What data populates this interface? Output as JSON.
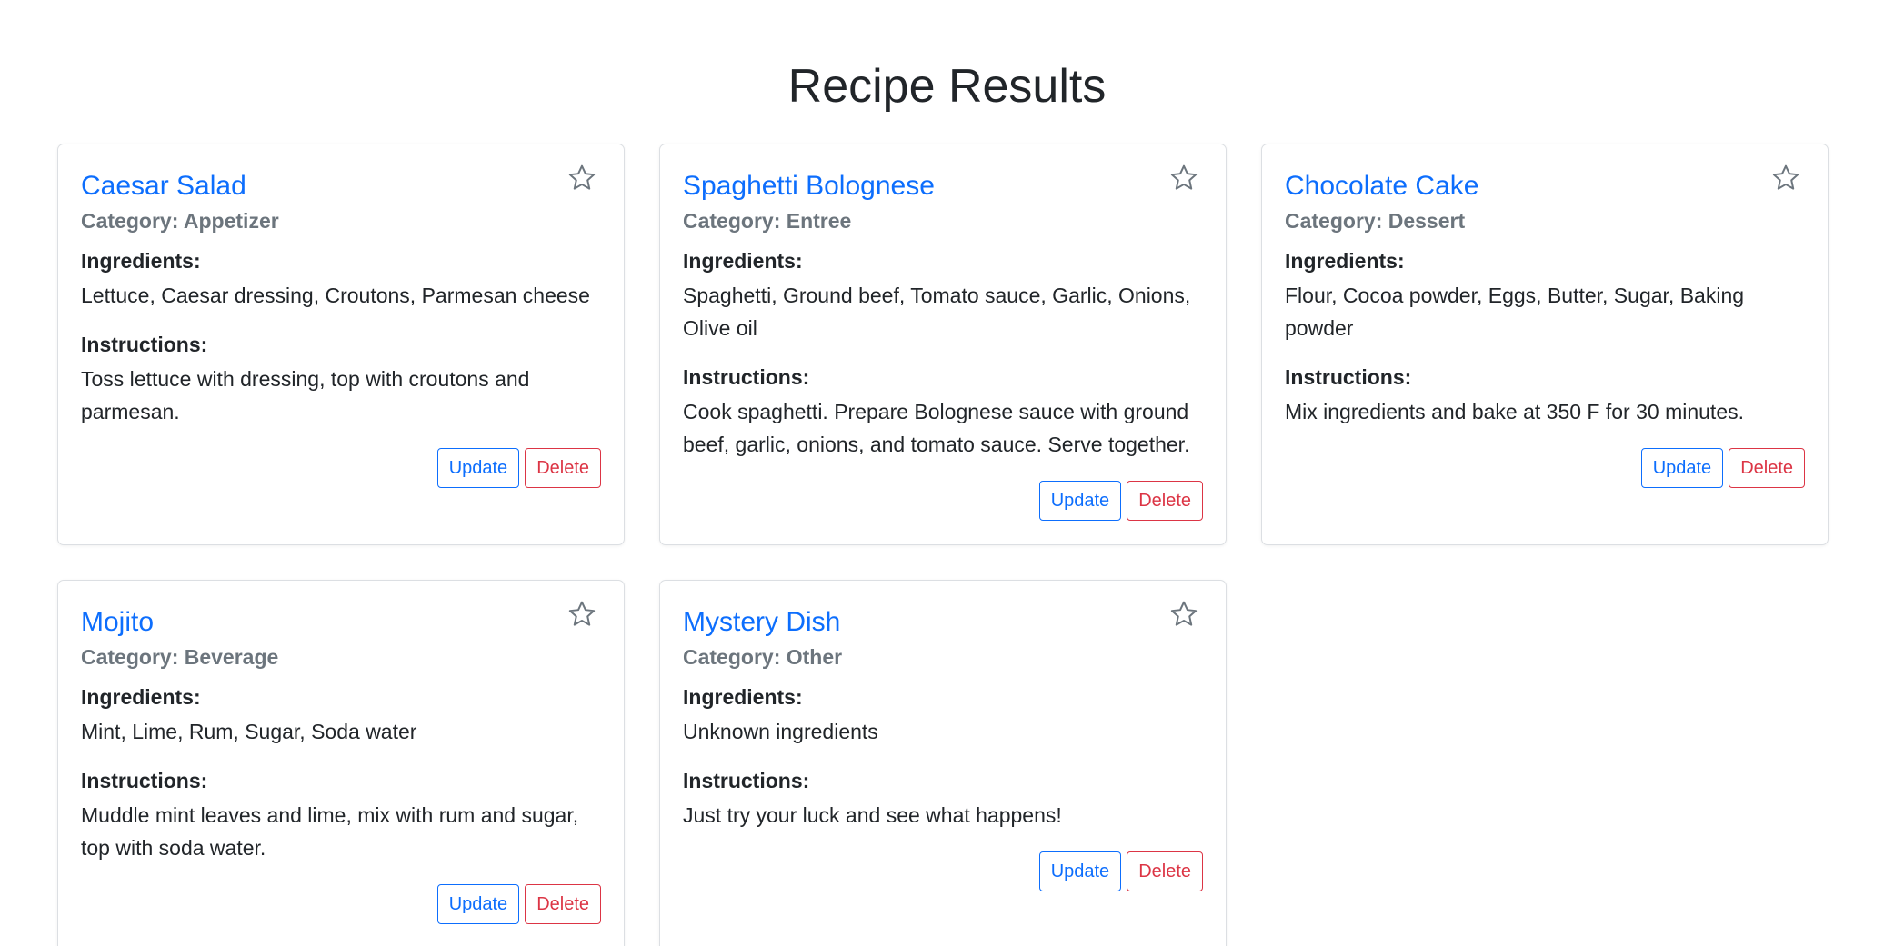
{
  "page": {
    "title": "Recipe Results"
  },
  "colors": {
    "accent": "#0d6efd",
    "danger": "#dc3545",
    "muted": "#6c757d",
    "text": "#212529",
    "star_outline": "#6c757d"
  },
  "labels": {
    "ingredients": "Ingredients:",
    "instructions": "Instructions:",
    "update": "Update",
    "delete": "Delete"
  },
  "recipes": [
    {
      "name": "Caesar Salad",
      "category": "Category: Appetizer",
      "ingredients": "Lettuce, Caesar dressing, Croutons, Parmesan cheese",
      "instructions": "Toss lettuce with dressing, top with croutons and parmesan.",
      "favorite_icon": "star-outline-icon"
    },
    {
      "name": "Spaghetti Bolognese",
      "category": "Category: Entree",
      "ingredients": "Spaghetti, Ground beef, Tomato sauce, Garlic, Onions, Olive oil",
      "instructions": "Cook spaghetti. Prepare Bolognese sauce with ground beef, garlic, onions, and tomato sauce. Serve together.",
      "favorite_icon": "star-outline-icon"
    },
    {
      "name": "Chocolate Cake",
      "category": "Category: Dessert",
      "ingredients": "Flour, Cocoa powder, Eggs, Butter, Sugar, Baking powder",
      "instructions": "Mix ingredients and bake at 350 F for 30 minutes.",
      "favorite_icon": "star-outline-icon"
    },
    {
      "name": "Mojito",
      "category": "Category: Beverage",
      "ingredients": "Mint, Lime, Rum, Sugar, Soda water",
      "instructions": "Muddle mint leaves and lime, mix with rum and sugar, top with soda water.",
      "favorite_icon": "star-outline-icon"
    },
    {
      "name": "Mystery Dish",
      "category": "Category: Other",
      "ingredients": "Unknown ingredients",
      "instructions": "Just try your luck and see what happens!",
      "favorite_icon": "star-outline-icon"
    }
  ]
}
